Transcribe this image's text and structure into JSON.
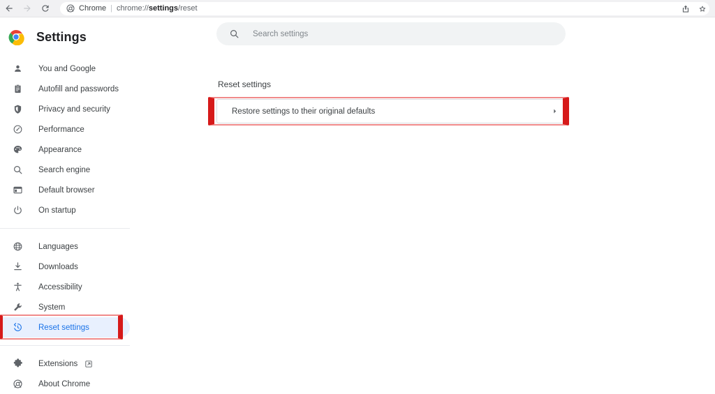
{
  "browser": {
    "nav": {
      "back_icon": "arrow-left-icon",
      "forward_icon": "arrow-right-icon",
      "reload_icon": "reload-icon"
    },
    "omnibox": {
      "favicon": "chrome-favicon",
      "app_name": "Chrome",
      "separator": "|",
      "url_prefix": "chrome://",
      "url_bold": "settings",
      "url_suffix": "/reset",
      "full_url": "chrome://settings/reset"
    },
    "actions": [
      {
        "name": "share-icon",
        "label": "Share"
      },
      {
        "name": "bookmark-star-icon",
        "label": "Bookmark this tab"
      }
    ]
  },
  "header": {
    "logo": "chrome-logo",
    "title": "Settings"
  },
  "search": {
    "icon": "search-icon",
    "placeholder": "Search settings",
    "value": ""
  },
  "sidebar": {
    "groups": [
      {
        "items": [
          {
            "label": "You and Google",
            "icon": "person-icon",
            "selected": false
          },
          {
            "label": "Autofill and passwords",
            "icon": "clipboard-icon",
            "selected": false
          },
          {
            "label": "Privacy and security",
            "icon": "shield-icon",
            "selected": false
          },
          {
            "label": "Performance",
            "icon": "speedometer-icon",
            "selected": false
          },
          {
            "label": "Appearance",
            "icon": "palette-icon",
            "selected": false
          },
          {
            "label": "Search engine",
            "icon": "search-icon",
            "selected": false
          },
          {
            "label": "Default browser",
            "icon": "browser-window-icon",
            "selected": false
          },
          {
            "label": "On startup",
            "icon": "power-icon",
            "selected": false
          }
        ]
      },
      {
        "items": [
          {
            "label": "Languages",
            "icon": "globe-icon",
            "selected": false
          },
          {
            "label": "Downloads",
            "icon": "download-icon",
            "selected": false
          },
          {
            "label": "Accessibility",
            "icon": "accessibility-icon",
            "selected": false
          },
          {
            "label": "System",
            "icon": "wrench-icon",
            "selected": false
          },
          {
            "label": "Reset settings",
            "icon": "history-reset-icon",
            "selected": true
          }
        ]
      },
      {
        "items": [
          {
            "label": "Extensions",
            "icon": "puzzle-icon",
            "external_icon": "external-link-icon",
            "selected": false
          },
          {
            "label": "About Chrome",
            "icon": "chrome-outline-icon",
            "selected": false
          }
        ]
      }
    ]
  },
  "main": {
    "section_title": "Reset settings",
    "cards": [
      {
        "label": "Restore settings to their original defaults",
        "chevron": "chevron-right-icon"
      }
    ]
  },
  "annotations": {
    "sidebar_highlight": "red-box-around-reset-settings",
    "card_highlight": "red-box-around-restore-defaults"
  },
  "colors": {
    "accent_blue": "#1a73e8",
    "selected_bg": "#e8f0fe",
    "annotation_red": "#d61a1a",
    "annotation_red_light": "#f08a8a",
    "text_primary": "#3c4043",
    "toolbar_bg": "#f1f1f3",
    "search_bg": "#f1f3f4"
  }
}
